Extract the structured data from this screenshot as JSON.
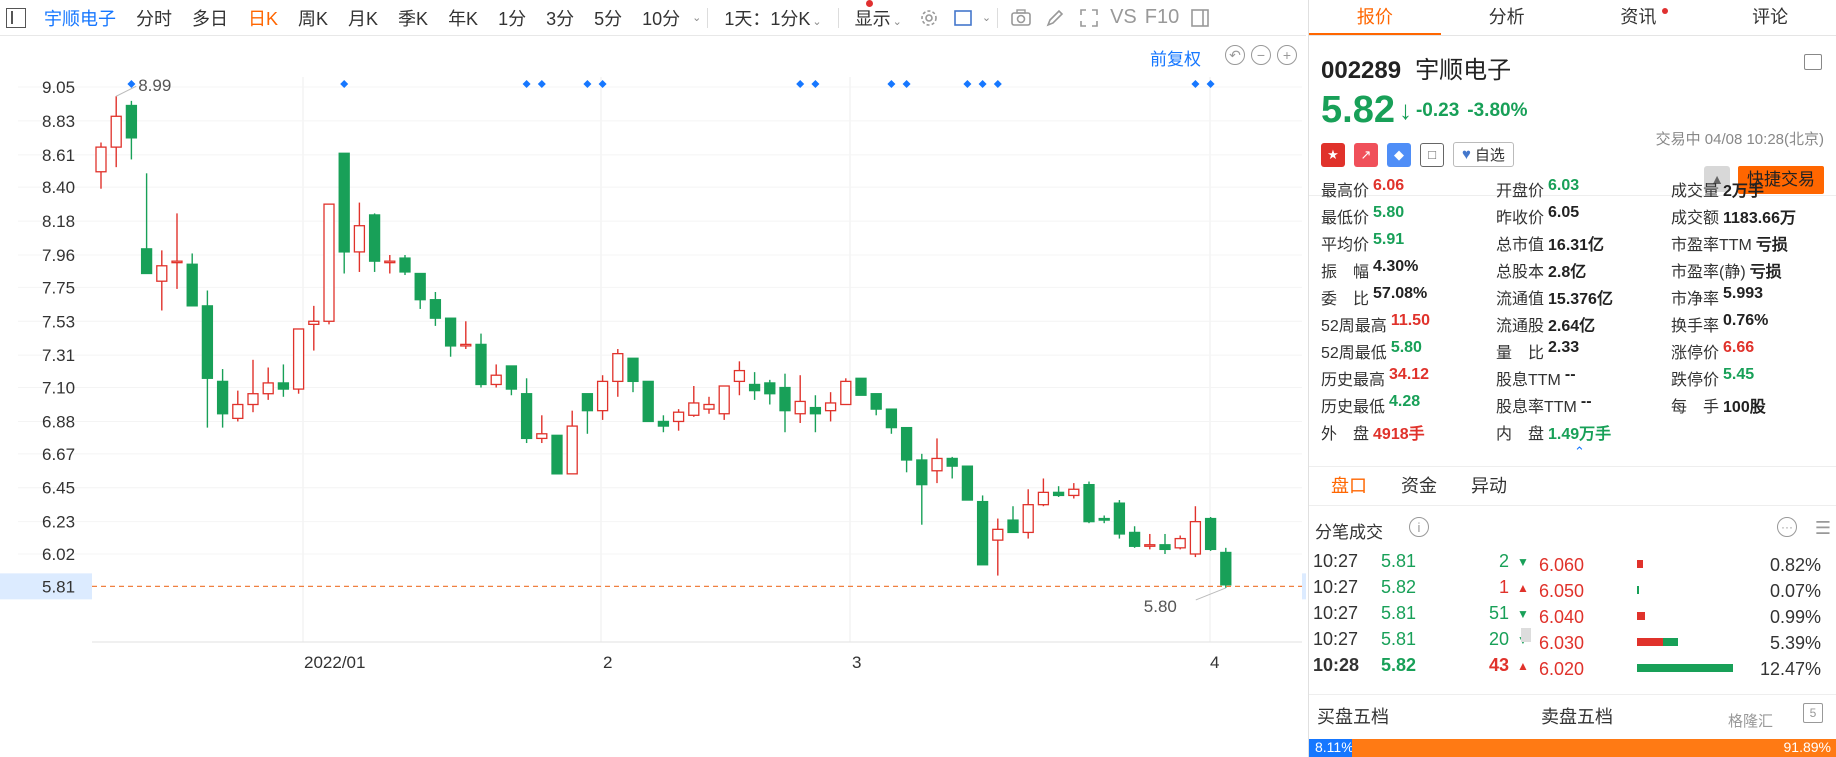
{
  "toolbar": {
    "first_label": "宇顺电子",
    "periods": [
      "分时",
      "多日",
      "日K",
      "周K",
      "月K",
      "季K",
      "年K",
      "1分",
      "3分",
      "5分",
      "10分"
    ],
    "active_period": "日K",
    "interval_label": "1天：1分K",
    "display_label": "显示",
    "vs_label": "VS",
    "f10_label": "F10"
  },
  "chart": {
    "adjust_label": "前复权",
    "hi_label": "8.99",
    "lo_label": "5.80",
    "current_label": "5.81",
    "dates": [
      "2022/01",
      "2",
      "3",
      "4"
    ]
  },
  "chart_data": {
    "type": "candlestick",
    "y_ticks": [
      9.05,
      8.83,
      8.61,
      8.4,
      8.18,
      7.96,
      7.75,
      7.53,
      7.31,
      7.1,
      6.88,
      6.67,
      6.45,
      6.23,
      6.02
    ],
    "y_ticks_right": [
      9.05,
      8.83,
      8.61,
      8.4,
      8.18,
      7.96,
      7.75,
      7.53,
      7.31,
      7.1,
      6.88,
      6.67,
      6.45,
      6.23,
      6.02
    ],
    "x_labels": [
      "2022/01",
      "2",
      "3",
      "4"
    ],
    "current_price_line": 5.81,
    "candles": [
      {
        "o": 8.5,
        "c": 8.66,
        "h": 8.69,
        "l": 8.39
      },
      {
        "o": 8.66,
        "c": 8.86,
        "h": 8.99,
        "l": 8.53
      },
      {
        "o": 8.93,
        "c": 8.72,
        "h": 8.96,
        "l": 8.58
      },
      {
        "o": 8.0,
        "c": 7.84,
        "h": 8.49,
        "l": 7.84
      },
      {
        "o": 7.79,
        "c": 7.89,
        "h": 7.99,
        "l": 7.6
      },
      {
        "o": 7.92,
        "c": 7.92,
        "h": 8.23,
        "l": 7.74
      },
      {
        "o": 7.9,
        "c": 7.63,
        "h": 7.97,
        "l": 7.63
      },
      {
        "o": 7.63,
        "c": 7.16,
        "h": 7.73,
        "l": 6.84
      },
      {
        "o": 7.14,
        "c": 6.93,
        "h": 7.22,
        "l": 6.84
      },
      {
        "o": 6.9,
        "c": 6.99,
        "h": 7.08,
        "l": 6.88
      },
      {
        "o": 6.99,
        "c": 7.06,
        "h": 7.28,
        "l": 6.94
      },
      {
        "o": 7.06,
        "c": 7.13,
        "h": 7.23,
        "l": 7.02
      },
      {
        "o": 7.13,
        "c": 7.09,
        "h": 7.25,
        "l": 7.04
      },
      {
        "o": 7.09,
        "c": 7.48,
        "h": 7.48,
        "l": 7.06
      },
      {
        "o": 7.51,
        "c": 7.53,
        "h": 7.63,
        "l": 7.34
      },
      {
        "o": 7.53,
        "c": 8.29,
        "h": 8.29,
        "l": 7.51
      },
      {
        "o": 8.62,
        "c": 7.98,
        "h": 8.62,
        "l": 7.84
      },
      {
        "o": 7.98,
        "c": 8.15,
        "h": 8.3,
        "l": 7.85
      },
      {
        "o": 8.22,
        "c": 7.92,
        "h": 8.23,
        "l": 7.85
      },
      {
        "o": 7.92,
        "c": 7.92,
        "h": 7.96,
        "l": 7.84
      },
      {
        "o": 7.94,
        "c": 7.85,
        "h": 7.96,
        "l": 7.83
      },
      {
        "o": 7.84,
        "c": 7.67,
        "h": 7.84,
        "l": 7.61
      },
      {
        "o": 7.67,
        "c": 7.55,
        "h": 7.72,
        "l": 7.5
      },
      {
        "o": 7.55,
        "c": 7.37,
        "h": 7.55,
        "l": 7.3
      },
      {
        "o": 7.37,
        "c": 7.38,
        "h": 7.53,
        "l": 7.35
      },
      {
        "o": 7.38,
        "c": 7.12,
        "h": 7.45,
        "l": 7.1
      },
      {
        "o": 7.12,
        "c": 7.18,
        "h": 7.25,
        "l": 7.1
      },
      {
        "o": 7.24,
        "c": 7.09,
        "h": 7.24,
        "l": 7.05
      },
      {
        "o": 7.06,
        "c": 6.77,
        "h": 7.16,
        "l": 6.74
      },
      {
        "o": 6.77,
        "c": 6.8,
        "h": 6.92,
        "l": 6.74
      },
      {
        "o": 6.79,
        "c": 6.54,
        "h": 6.79,
        "l": 6.54
      },
      {
        "o": 6.54,
        "c": 6.85,
        "h": 6.95,
        "l": 6.54
      },
      {
        "o": 7.06,
        "c": 6.95,
        "h": 7.06,
        "l": 6.8
      },
      {
        "o": 6.95,
        "c": 7.14,
        "h": 7.18,
        "l": 6.89
      },
      {
        "o": 7.14,
        "c": 7.32,
        "h": 7.35,
        "l": 7.04
      },
      {
        "o": 7.29,
        "c": 7.14,
        "h": 7.29,
        "l": 7.07
      },
      {
        "o": 7.14,
        "c": 6.88,
        "h": 7.14,
        "l": 6.88
      },
      {
        "o": 6.88,
        "c": 6.85,
        "h": 6.92,
        "l": 6.81
      },
      {
        "o": 6.88,
        "c": 6.94,
        "h": 6.96,
        "l": 6.82
      },
      {
        "o": 6.92,
        "c": 7.0,
        "h": 7.11,
        "l": 6.91
      },
      {
        "o": 6.96,
        "c": 6.99,
        "h": 7.04,
        "l": 6.93
      },
      {
        "o": 6.93,
        "c": 7.11,
        "h": 7.11,
        "l": 6.89
      },
      {
        "o": 7.14,
        "c": 7.21,
        "h": 7.27,
        "l": 7.05
      },
      {
        "o": 7.12,
        "c": 7.08,
        "h": 7.2,
        "l": 7.02
      },
      {
        "o": 7.13,
        "c": 7.06,
        "h": 7.15,
        "l": 6.99
      },
      {
        "o": 7.1,
        "c": 6.95,
        "h": 7.19,
        "l": 6.81
      },
      {
        "o": 6.93,
        "c": 7.01,
        "h": 7.18,
        "l": 6.87
      },
      {
        "o": 6.97,
        "c": 6.93,
        "h": 7.05,
        "l": 6.81
      },
      {
        "o": 6.95,
        "c": 7.0,
        "h": 7.07,
        "l": 6.88
      },
      {
        "o": 6.99,
        "c": 7.14,
        "h": 7.16,
        "l": 6.99
      },
      {
        "o": 7.16,
        "c": 7.05,
        "h": 7.16,
        "l": 7.05
      },
      {
        "o": 7.06,
        "c": 6.96,
        "h": 7.06,
        "l": 6.92
      },
      {
        "o": 6.96,
        "c": 6.84,
        "h": 6.96,
        "l": 6.8
      },
      {
        "o": 6.84,
        "c": 6.63,
        "h": 6.84,
        "l": 6.55
      },
      {
        "o": 6.63,
        "c": 6.47,
        "h": 6.67,
        "l": 6.21
      },
      {
        "o": 6.56,
        "c": 6.64,
        "h": 6.77,
        "l": 6.48
      },
      {
        "o": 6.64,
        "c": 6.59,
        "h": 6.65,
        "l": 6.51
      },
      {
        "o": 6.59,
        "c": 6.37,
        "h": 6.59,
        "l": 6.37
      },
      {
        "o": 6.36,
        "c": 5.95,
        "h": 6.4,
        "l": 5.95
      },
      {
        "o": 6.11,
        "c": 6.18,
        "h": 6.25,
        "l": 5.88
      },
      {
        "o": 6.24,
        "c": 6.16,
        "h": 6.33,
        "l": 6.16
      },
      {
        "o": 6.16,
        "c": 6.34,
        "h": 6.44,
        "l": 6.12
      },
      {
        "o": 6.34,
        "c": 6.42,
        "h": 6.51,
        "l": 6.33
      },
      {
        "o": 6.42,
        "c": 6.4,
        "h": 6.46,
        "l": 6.39
      },
      {
        "o": 6.4,
        "c": 6.44,
        "h": 6.48,
        "l": 6.38
      },
      {
        "o": 6.47,
        "c": 6.23,
        "h": 6.49,
        "l": 6.22
      },
      {
        "o": 6.25,
        "c": 6.24,
        "h": 6.27,
        "l": 6.22
      },
      {
        "o": 6.35,
        "c": 6.15,
        "h": 6.37,
        "l": 6.12
      },
      {
        "o": 6.16,
        "c": 6.07,
        "h": 6.2,
        "l": 6.06
      },
      {
        "o": 6.08,
        "c": 6.08,
        "h": 6.15,
        "l": 6.05
      },
      {
        "o": 6.08,
        "c": 6.05,
        "h": 6.15,
        "l": 6.02
      },
      {
        "o": 6.06,
        "c": 6.12,
        "h": 6.14,
        "l": 6.05
      },
      {
        "o": 6.02,
        "c": 6.23,
        "h": 6.33,
        "l": 6.0
      },
      {
        "o": 6.25,
        "c": 6.05,
        "h": 6.26,
        "l": 6.04
      },
      {
        "o": 6.03,
        "c": 5.82,
        "h": 6.06,
        "l": 5.8
      }
    ],
    "markers_index": [
      2,
      16,
      28,
      29,
      32,
      33,
      46,
      47,
      52,
      53,
      57,
      58,
      59,
      72,
      73
    ]
  },
  "right": {
    "tabs": [
      "报价",
      "分析",
      "资讯",
      "评论"
    ],
    "active_tab": "报价",
    "code": "002289",
    "name": "宇顺电子",
    "price": "5.82",
    "change": "-0.23",
    "change_pct": "-3.80%",
    "timestamp": "交易中 04/08 10:28(北京)",
    "watch_label": "自选",
    "fast_trade": "快捷交易",
    "stats": [
      [
        {
          "l": "最高价",
          "v": "6.06",
          "c": "red"
        },
        {
          "l": "开盘价",
          "v": "6.03",
          "c": "green"
        },
        {
          "l": "成交量",
          "v": "2万手",
          "c": ""
        }
      ],
      [
        {
          "l": "最低价",
          "v": "5.80",
          "c": "green"
        },
        {
          "l": "昨收价",
          "v": "6.05",
          "c": ""
        },
        {
          "l": "成交额",
          "v": "1183.66万",
          "c": ""
        }
      ],
      [
        {
          "l": "平均价",
          "v": "5.91",
          "c": "green"
        },
        {
          "l": "总市值",
          "v": "16.31亿",
          "c": ""
        },
        {
          "l": "市盈率TTM",
          "v": "亏损",
          "c": ""
        }
      ],
      [
        {
          "l": "振　幅",
          "v": "4.30%",
          "c": ""
        },
        {
          "l": "总股本",
          "v": "2.8亿",
          "c": ""
        },
        {
          "l": "市盈率(静)",
          "v": "亏损",
          "c": ""
        }
      ],
      [
        {
          "l": "委　比",
          "v": "57.08%",
          "c": ""
        },
        {
          "l": "流通值",
          "v": "15.376亿",
          "c": ""
        },
        {
          "l": "市净率",
          "v": "5.993",
          "c": ""
        }
      ],
      [
        {
          "l": "52周最高",
          "v": "11.50",
          "c": "red"
        },
        {
          "l": "流通股",
          "v": "2.64亿",
          "c": ""
        },
        {
          "l": "换手率",
          "v": "0.76%",
          "c": ""
        }
      ],
      [
        {
          "l": "52周最低",
          "v": "5.80",
          "c": "green"
        },
        {
          "l": "量　比",
          "v": "2.33",
          "c": ""
        },
        {
          "l": "涨停价",
          "v": "6.66",
          "c": "red"
        }
      ],
      [
        {
          "l": "历史最高",
          "v": "34.12",
          "c": "red"
        },
        {
          "l": "股息TTM",
          "v": "--",
          "c": ""
        },
        {
          "l": "跌停价",
          "v": "5.45",
          "c": "green"
        }
      ],
      [
        {
          "l": "历史最低",
          "v": "4.28",
          "c": "green"
        },
        {
          "l": "股息率TTM",
          "v": "--",
          "c": ""
        },
        {
          "l": "每　手",
          "v": "100股",
          "c": ""
        }
      ],
      [
        {
          "l": "外　盘",
          "v": "4918手",
          "c": "red"
        },
        {
          "l": "内　盘",
          "v": "1.49万手",
          "c": "green"
        },
        {
          "l": "",
          "v": "",
          "c": ""
        }
      ]
    ],
    "subtabs": [
      "盘口",
      "资金",
      "异动"
    ],
    "active_subtab": "盘口",
    "ticks_title": "分笔成交",
    "ticks": [
      {
        "t": "10:27",
        "p": "5.81",
        "v": "2",
        "dir": "down"
      },
      {
        "t": "10:27",
        "p": "5.82",
        "v": "1",
        "dir": "up"
      },
      {
        "t": "10:27",
        "p": "5.81",
        "v": "51",
        "dir": "down"
      },
      {
        "t": "10:27",
        "p": "5.81",
        "v": "20",
        "dir": "down"
      },
      {
        "t": "10:28",
        "p": "5.82",
        "v": "43",
        "dir": "up"
      }
    ],
    "dist": [
      {
        "p": "6.060",
        "pct": "0.82%",
        "red": 0.0082,
        "green": 0
      },
      {
        "p": "6.050",
        "pct": "0.07%",
        "red": 0,
        "green": 0.0007
      },
      {
        "p": "6.040",
        "pct": "0.99%",
        "red": 0.0099,
        "green": 0
      },
      {
        "p": "6.030",
        "pct": "5.39%",
        "red": 0.0333,
        "green": 0.0206
      },
      {
        "p": "6.020",
        "pct": "12.47%",
        "red": 0,
        "green": 0.1247
      }
    ],
    "bid_title": "买盘五档",
    "ask_title": "卖盘五档",
    "buy_ratio": "8.11%",
    "sell_ratio": "91.89%",
    "buy_ratio_value": 0.0811,
    "watermark": "格隆汇"
  },
  "colors": {
    "up": "#e0322b",
    "down": "#18a058",
    "accent": "#ff6600",
    "link": "#1677ff"
  }
}
